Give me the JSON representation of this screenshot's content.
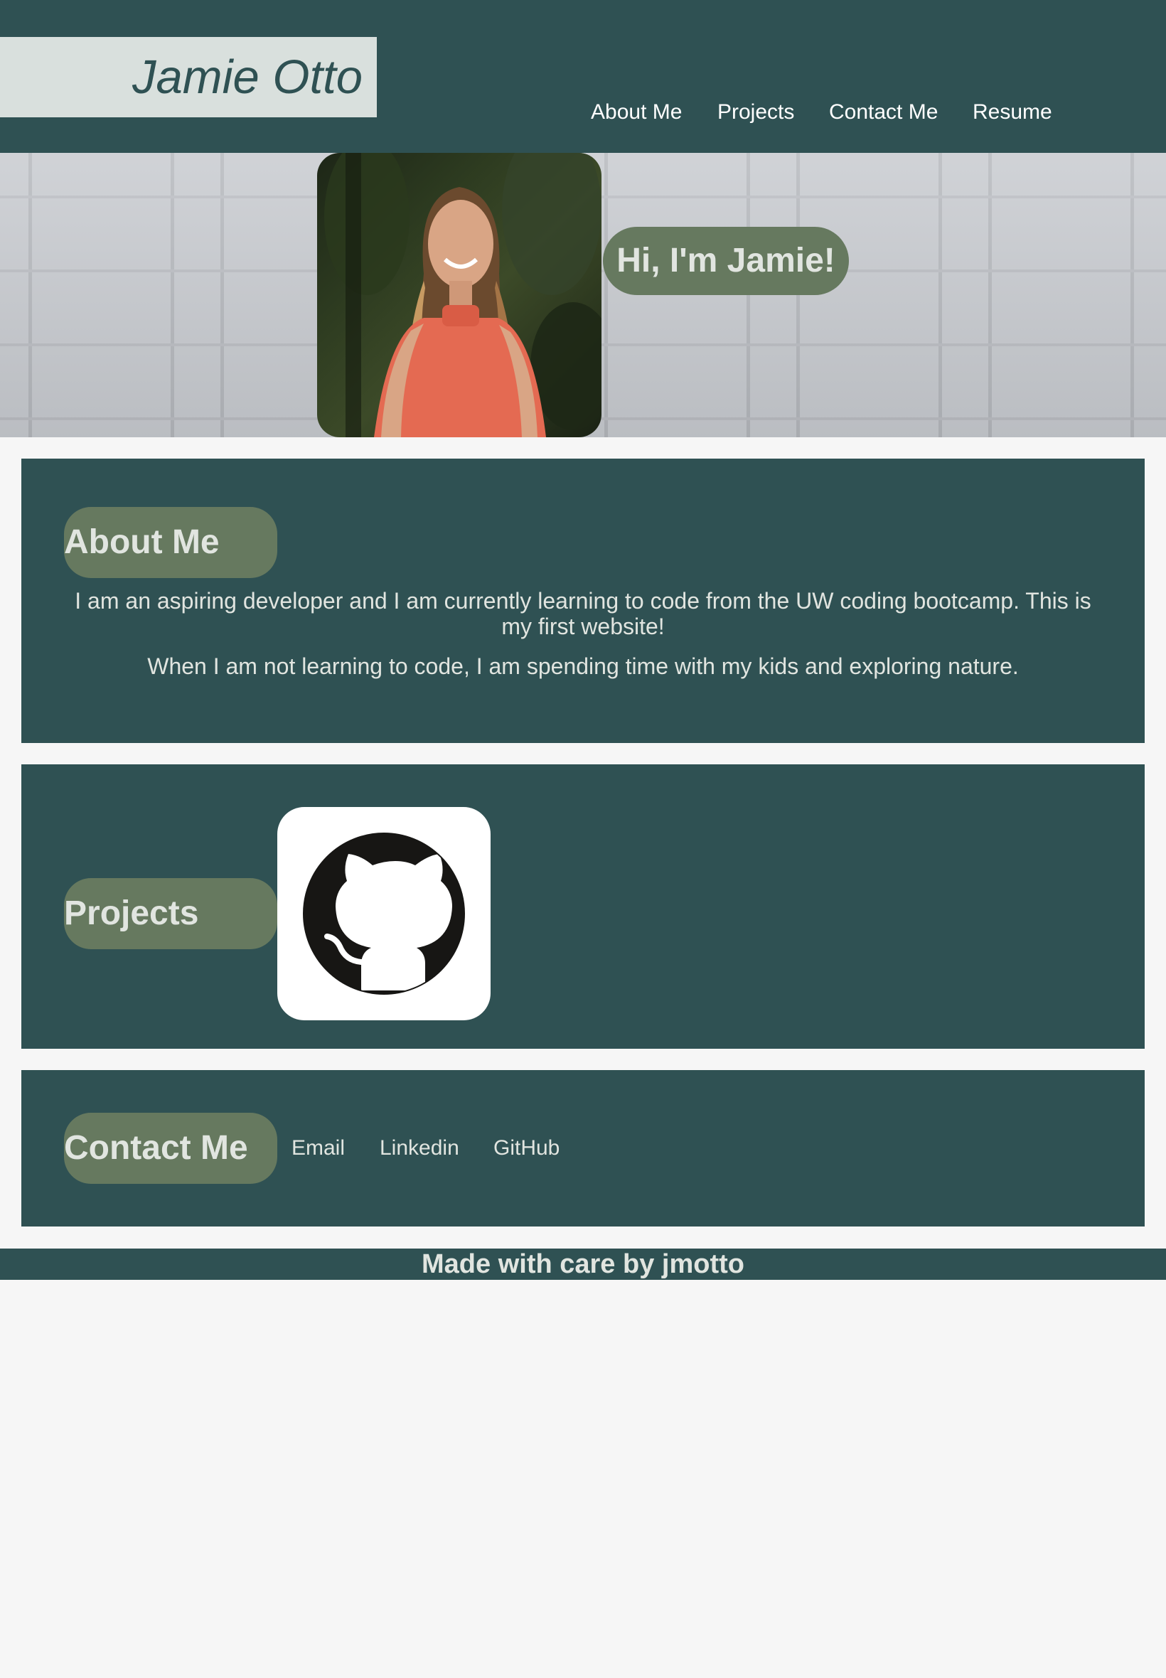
{
  "header": {
    "logo_text": "Jamie Otto",
    "nav": [
      {
        "label": "About Me"
      },
      {
        "label": "Projects"
      },
      {
        "label": "Contact Me"
      },
      {
        "label": "Resume"
      }
    ]
  },
  "hero": {
    "greeting": "Hi, I'm Jamie!"
  },
  "about": {
    "title": "About Me",
    "paragraphs": [
      "I am an aspiring developer and I am currently learning to code from the UW coding bootcamp. This is my first website!",
      "When I am not learning to code, I am spending time with my kids and exploring nature."
    ]
  },
  "projects": {
    "title": "Projects",
    "icon": "github-icon"
  },
  "contact": {
    "title": "Contact Me",
    "links": [
      {
        "label": "Email"
      },
      {
        "label": "Linkedin"
      },
      {
        "label": "GitHub"
      }
    ]
  },
  "footer": {
    "text": "Made with care by jmotto"
  },
  "colors": {
    "primary": "#2f5153",
    "pill": "#66795f",
    "light_text": "#e1e5e0",
    "logo_bg": "#d9e0dd",
    "page_bg": "#f6f6f6"
  }
}
